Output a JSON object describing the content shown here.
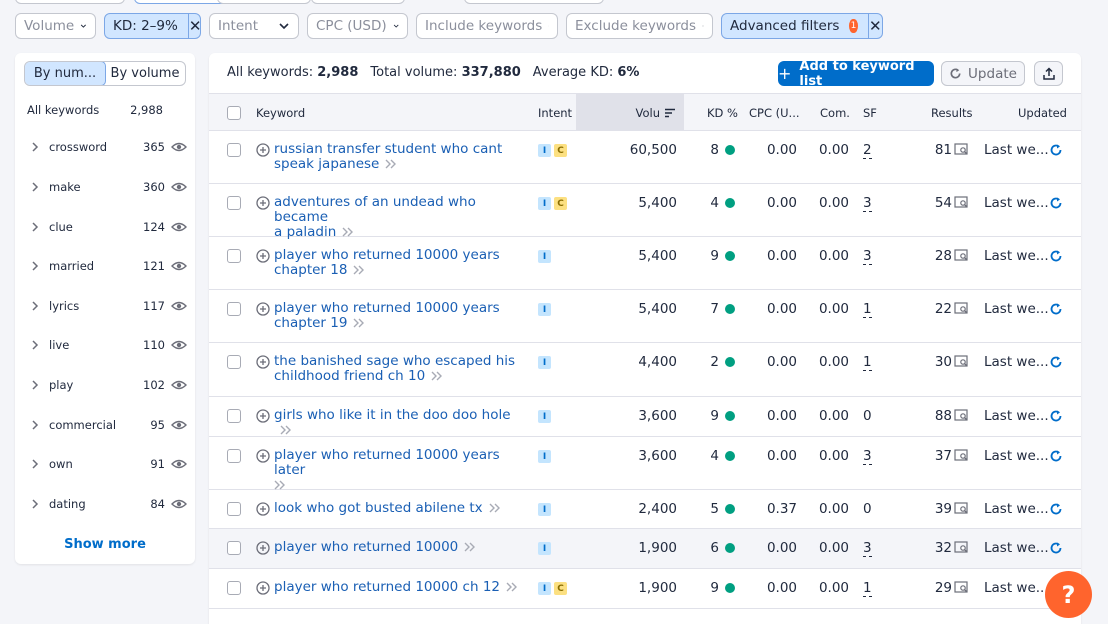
{
  "filters": {
    "volume": "Volume",
    "kd": "KD: 2–9%",
    "intent": "Intent",
    "cpc": "CPC (USD)",
    "include": "Include keywords",
    "exclude": "Exclude keywords",
    "advanced": "Advanced filters",
    "advanced_count": "1"
  },
  "sidebar": {
    "tab_number": "By num...",
    "tab_volume": "By volume",
    "all_label": "All keywords",
    "all_count": "2,988",
    "groups": [
      {
        "label": "crossword",
        "count": "365"
      },
      {
        "label": "make",
        "count": "360"
      },
      {
        "label": "clue",
        "count": "124"
      },
      {
        "label": "married",
        "count": "121"
      },
      {
        "label": "lyrics",
        "count": "117"
      },
      {
        "label": "live",
        "count": "110"
      },
      {
        "label": "play",
        "count": "102"
      },
      {
        "label": "commercial",
        "count": "95"
      },
      {
        "label": "own",
        "count": "91"
      },
      {
        "label": "dating",
        "count": "84"
      }
    ],
    "show_more": "Show more"
  },
  "summary": {
    "all_label": "All keywords:",
    "all_value": "2,988",
    "volume_label": "Total volume:",
    "volume_value": "337,880",
    "kd_label": "Average KD:",
    "kd_value": "6%"
  },
  "toolbar": {
    "add": "Add to keyword list",
    "update": "Update"
  },
  "columns": {
    "keyword": "Keyword",
    "intent": "Intent",
    "volume": "Volu",
    "kd": "KD %",
    "cpc": "CPC (U...",
    "com": "Com.",
    "sf": "SF",
    "results": "Results",
    "updated": "Updated"
  },
  "rows": [
    {
      "line1": "russian transfer student who cant",
      "line2": "speak japanese",
      "intent": [
        "I",
        "C"
      ],
      "volume": "60,500",
      "kd": "8",
      "cpc": "0.00",
      "com": "0.00",
      "sf": "2",
      "results": "81",
      "updated": "Last we..."
    },
    {
      "line1": "adventures of an undead who became",
      "line2": "a paladin",
      "intent": [
        "I",
        "C"
      ],
      "volume": "5,400",
      "kd": "4",
      "cpc": "0.00",
      "com": "0.00",
      "sf": "3",
      "results": "54",
      "updated": "Last we..."
    },
    {
      "line1": "player who returned 10000 years",
      "line2": "chapter 18",
      "intent": [
        "I"
      ],
      "volume": "5,400",
      "kd": "9",
      "cpc": "0.00",
      "com": "0.00",
      "sf": "3",
      "results": "28",
      "updated": "Last we..."
    },
    {
      "line1": "player who returned 10000 years",
      "line2": "chapter 19",
      "intent": [
        "I"
      ],
      "volume": "5,400",
      "kd": "7",
      "cpc": "0.00",
      "com": "0.00",
      "sf": "1",
      "results": "22",
      "updated": "Last we..."
    },
    {
      "line1": "the banished sage who escaped his",
      "line2": "childhood friend ch 10",
      "intent": [
        "I"
      ],
      "volume": "4,400",
      "kd": "2",
      "cpc": "0.00",
      "com": "0.00",
      "sf": "1",
      "results": "30",
      "updated": "Last we..."
    },
    {
      "line1": "girls who like it in the doo doo hole",
      "line2": "",
      "intent": [
        "I"
      ],
      "volume": "3,600",
      "kd": "9",
      "cpc": "0.00",
      "com": "0.00",
      "sf": "0",
      "results": "88",
      "updated": "Last we..."
    },
    {
      "line1": "player who returned 10000 years later",
      "line2": "",
      "intent": [
        "I"
      ],
      "volume": "3,600",
      "kd": "4",
      "cpc": "0.00",
      "com": "0.00",
      "sf": "3",
      "results": "37",
      "updated": "Last we..."
    },
    {
      "line1": "look who got busted abilene tx",
      "line2": "",
      "intent": [
        "I"
      ],
      "volume": "2,400",
      "kd": "5",
      "cpc": "0.37",
      "com": "0.00",
      "sf": "0",
      "results": "39",
      "updated": "Last we..."
    },
    {
      "line1": "player who returned 10000",
      "line2": "",
      "intent": [
        "I"
      ],
      "volume": "1,900",
      "kd": "6",
      "cpc": "0.00",
      "com": "0.00",
      "sf": "3",
      "results": "32",
      "updated": "Last we..."
    },
    {
      "line1": "player who returned 10000 ch 12",
      "line2": "",
      "intent": [
        "I",
        "C"
      ],
      "volume": "1,900",
      "kd": "9",
      "cpc": "0.00",
      "com": "0.00",
      "sf": "1",
      "results": "29",
      "updated": "Last we..."
    }
  ],
  "colors": {
    "primary": "#006dca",
    "kd_dot": "#009f81",
    "accent": "#ff642d"
  }
}
